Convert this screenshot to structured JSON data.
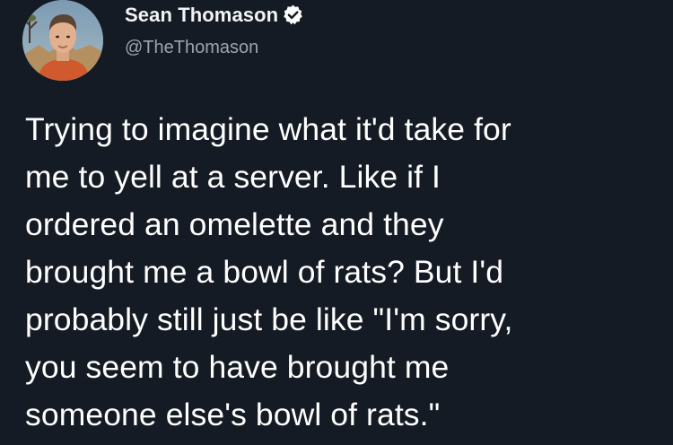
{
  "author": {
    "display_name": "Sean Thomason",
    "handle": "@TheThomason",
    "verified": true,
    "avatar_icon": "user-avatar",
    "verified_icon": "verified-badge-icon",
    "verified_color": "#ffffff"
  },
  "tweet": {
    "text": "Trying to imagine what it'd take for\nme to yell at a server. Like if I\nordered an omelette and they\nbrought me a bowl of rats? But I'd\nprobably still just be like \"I'm sorry,\nyou seem to have brought me\nsomeone else's bowl of rats.\""
  },
  "theme": {
    "background": "#151b24",
    "text": "#ffffff",
    "secondary_text": "#9aa4ae"
  }
}
